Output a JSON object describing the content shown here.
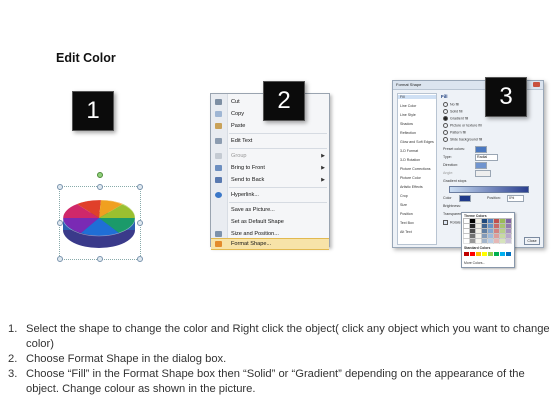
{
  "heading": "Edit Color",
  "step_badges": [
    "1",
    "2",
    "3"
  ],
  "context_menu": {
    "items": [
      {
        "label": "Cut",
        "icon": "scissors-icon",
        "disabled": false,
        "submenu": false
      },
      {
        "label": "Copy",
        "icon": "copy-icon",
        "disabled": false,
        "submenu": false
      },
      {
        "label": "Paste",
        "icon": "paste-icon",
        "disabled": false,
        "submenu": false
      },
      {
        "label": "Edit Text",
        "icon": "edit-text-icon",
        "disabled": false,
        "submenu": false
      },
      {
        "label": "Group",
        "icon": "group-icon",
        "disabled": true,
        "submenu": true
      },
      {
        "label": "Bring to Front",
        "icon": "bring-front-icon",
        "disabled": false,
        "submenu": true
      },
      {
        "label": "Send to Back",
        "icon": "send-back-icon",
        "disabled": false,
        "submenu": true
      },
      {
        "label": "Hyperlink...",
        "icon": "hyperlink-icon",
        "disabled": false,
        "submenu": false
      },
      {
        "label": "Save as Picture...",
        "icon": "",
        "disabled": false,
        "submenu": false
      },
      {
        "label": "Set as Default Shape",
        "icon": "",
        "disabled": false,
        "submenu": false
      },
      {
        "label": "Size and Position...",
        "icon": "size-position-icon",
        "disabled": false,
        "submenu": false
      },
      {
        "label": "Format Shape...",
        "icon": "format-shape-icon",
        "disabled": false,
        "submenu": false,
        "highlighted": true
      }
    ]
  },
  "format_dialog": {
    "title": "Format Shape",
    "categories": [
      "Fill",
      "Line Color",
      "Line Style",
      "Shadow",
      "Reflection",
      "Glow and Soft Edges",
      "3-D Format",
      "3-D Rotation",
      "Picture Corrections",
      "Picture Color",
      "Artistic Effects",
      "Crop",
      "Size",
      "Position",
      "Text Box",
      "Alt Text"
    ],
    "selected_category": "Fill",
    "pane_heading": "Fill",
    "fill_options": [
      {
        "label": "No fill",
        "selected": false
      },
      {
        "label": "Solid fill",
        "selected": false
      },
      {
        "label": "Gradient fill",
        "selected": true
      },
      {
        "label": "Picture or texture fill",
        "selected": false
      },
      {
        "label": "Pattern fill",
        "selected": false
      },
      {
        "label": "Slide background fill",
        "selected": false
      }
    ],
    "fields": {
      "preset": "Preset colors:",
      "type": "Type:",
      "type_value": "Radial",
      "direction": "Direction:",
      "angle": "Angle:",
      "gradient_stops": "Gradient stops",
      "color": "Color",
      "position": "Position:",
      "position_value": "0%",
      "brightness": "Brightness:",
      "transparency": "Transparency:",
      "rotate": "Rotate with shape"
    },
    "palette": {
      "theme_label": "Theme Colors",
      "standard_label": "Standard Colors",
      "more_label": "More Colors..."
    },
    "close_label": "Close"
  },
  "instructions": [
    {
      "num": "1.",
      "text": "Select the shape to change the color and Right click the object( click any object which you want to change color)"
    },
    {
      "num": "2.",
      "text": "Choose Format Shape in the dialog box."
    },
    {
      "num": "3.",
      "text": "Choose “Fill” in the Format Shape box then “Solid” or “Gradient” depending on the appearance of the object. Change colour as shown in the picture."
    }
  ]
}
